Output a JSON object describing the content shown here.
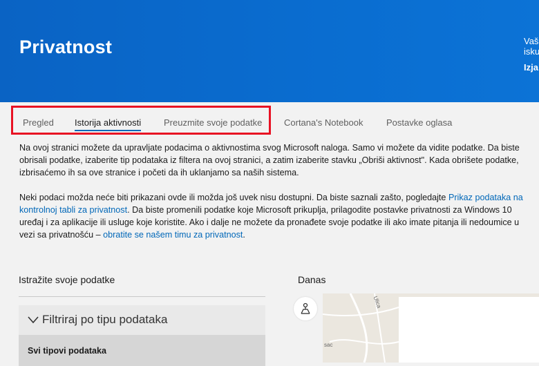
{
  "header": {
    "title": "Privatnost",
    "side_line1": "Vaš",
    "side_line2": "isku",
    "side_line3": "Izja"
  },
  "tabs": [
    {
      "label": "Pregled",
      "active": false
    },
    {
      "label": "Istorija aktivnosti",
      "active": true
    },
    {
      "label": "Preuzmite svoje podatke",
      "active": false
    },
    {
      "label": "Cortana's Notebook",
      "active": false
    },
    {
      "label": "Postavke oglasa",
      "active": false
    }
  ],
  "intro": {
    "line1": "Na ovoj stranici možete da upravljate podacima o aktivnostima svog Microsoft naloga. Samo vi možete da vidite podatke. Da biste",
    "line2": "obrisali podatke, izaberite tip podataka iz filtera na ovoj stranici, a zatim izaberite stavku „Obriši aktivnost\". Kada obrišete podatke,",
    "line3": "izbrisaćemo ih sa ove stranice i početi da ih uklanjamo sa naših sistema."
  },
  "info": {
    "line1_text": "Neki podaci možda neće biti prikazani ovde ili možda još uvek nisu dostupni. Da biste saznali zašto, pogledajte",
    "line1_link": "Prikaz podataka na",
    "line2_link": "kontrolnoj tabli za privatnost",
    "line2_text": ". Da biste promenili podatke koje Microsoft prikuplja, prilagodite postavke privatnosti za Windows 10",
    "line3_text": "uređaj i za aplikacije ili usluge koje koristite. Ako i dalje ne možete da pronađete svoje podatke ili ako imate pitanja ili nedoumice u",
    "line4_text": "vezi sa privatnošću –",
    "line4_link": "obratite se našem timu za privatnost",
    "line4_end": "."
  },
  "explore": {
    "title": "Istražite svoje podatke",
    "filter_label": "Filtriraj po tipu podataka",
    "all_types": "Svi tipovi podataka"
  },
  "today": {
    "title": "Danas",
    "map_labels": [
      "Ulica",
      "sac"
    ]
  },
  "colors": {
    "hero": "#0a6dd0",
    "accent": "#0067b8",
    "highlight": "#e81123"
  }
}
